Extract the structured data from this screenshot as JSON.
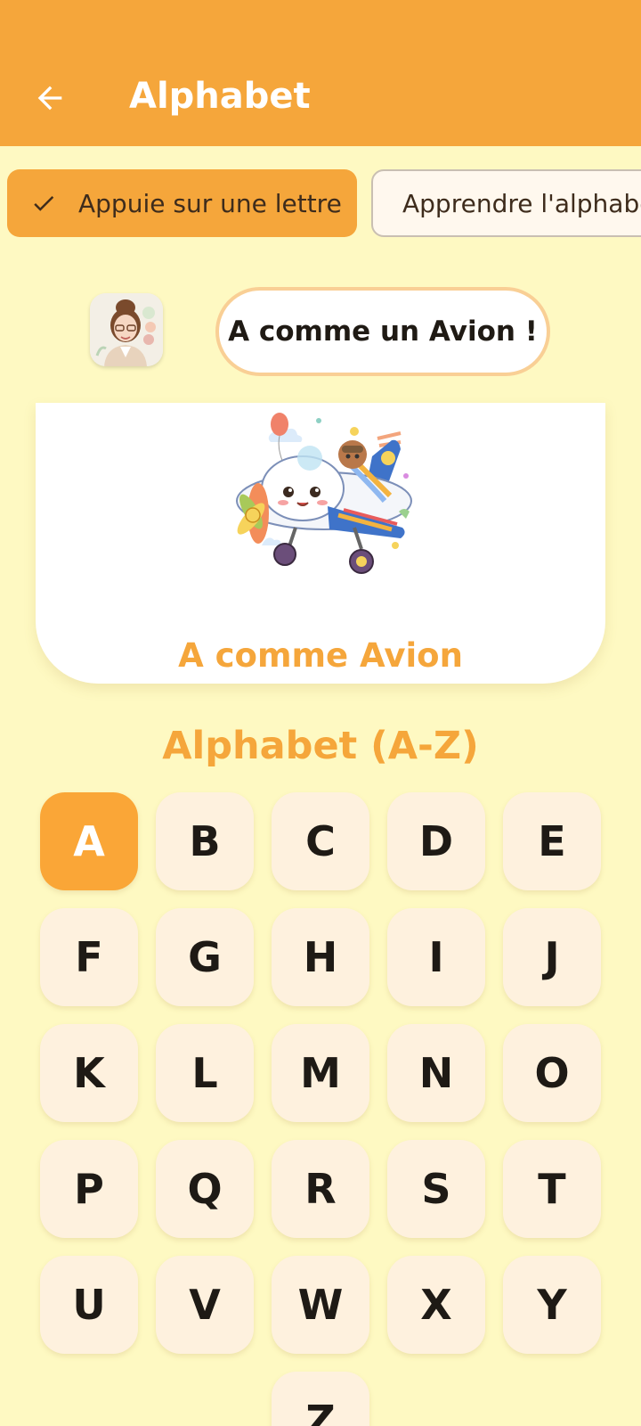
{
  "header": {
    "title": "Alphabet",
    "back_icon": "arrow-left-icon"
  },
  "modes": {
    "selected_label": "Appuie sur une lettre",
    "other_label": "Apprendre l'alphabet"
  },
  "prompt": {
    "bubble_text": "A comme un Avion !"
  },
  "card": {
    "caption": "A comme Avion"
  },
  "alphabet": {
    "title": "Alphabet (A-Z)",
    "selected": "A",
    "letters": [
      "A",
      "B",
      "C",
      "D",
      "E",
      "F",
      "G",
      "H",
      "I",
      "J",
      "K",
      "L",
      "M",
      "N",
      "O",
      "P",
      "Q",
      "R",
      "S",
      "T",
      "U",
      "V",
      "W",
      "X",
      "Y",
      "Z"
    ]
  },
  "colors": {
    "background": "#FEF9C2",
    "accent": "#F5A63B",
    "key": "#FEF1DE",
    "key_active": "#FAA637"
  }
}
